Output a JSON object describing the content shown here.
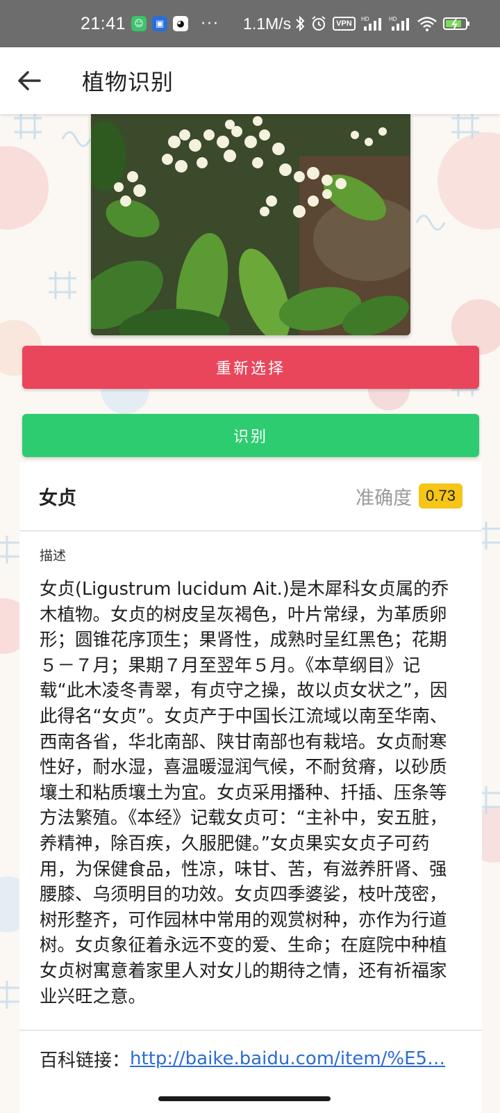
{
  "status_bar": {
    "time": "21:41",
    "dots": "···",
    "network_speed": "1.1M/s",
    "vpn": "VPN",
    "signal_1_tag": "HD",
    "signal_2_tag": "HD"
  },
  "app_bar": {
    "title": "植物识别",
    "back_icon": "arrow-left-icon"
  },
  "buttons": {
    "reselect_label": "重新选择",
    "identify_label": "识别"
  },
  "result": {
    "name": "女贞",
    "accuracy_label": "准确度",
    "accuracy_value": "0.73",
    "description_label": "描述",
    "description": "女贞(Ligustrum lucidum Ait.)是木犀科女贞属的乔木植物。女贞的树皮呈灰褐色，叶片常绿，为革质卵形；圆锥花序顶生；果肾性，成熟时呈红黑色；花期５－７月；果期７月至翌年５月。《本草纲目》记载“此木凌冬青翠，有贞守之操，故以贞女状之”，因此得名“女贞”。女贞产于中国长江流域以南至华南、西南各省，华北南部、陕甘南部也有栽培。女贞耐寒性好，耐水湿，喜温暖湿润气候，不耐贫瘠，以砂质壤土和粘质壤土为宜。女贞采用播种、扦插、压条等方法繁殖。《本经》记载女贞可：“主补中，安五脏，养精神，除百疾，久服肥健。”女贞果实女贞子可药用，为保健食品，性凉，味甘、苦，有滋养肝肾、强腰膝、乌须明目的功效。女贞四季婆娑，枝叶茂密，树形整齐，可作园林中常用的观赏树种，亦作为行道树。女贞象征着永远不变的爱、生命；在庭院中种植女贞树寓意着家里人对女儿的期待之情，还有祈福家业兴旺之意。",
    "link_label": "百科链接：",
    "link_url": "http://baike.baidu.com/item/%E5…"
  },
  "colors": {
    "reselect_button": "#e9465c",
    "identify_button": "#2ecc71",
    "accuracy_badge": "#f5c518",
    "link": "#2b6cd6",
    "status_bar": "#6d6d6d"
  }
}
